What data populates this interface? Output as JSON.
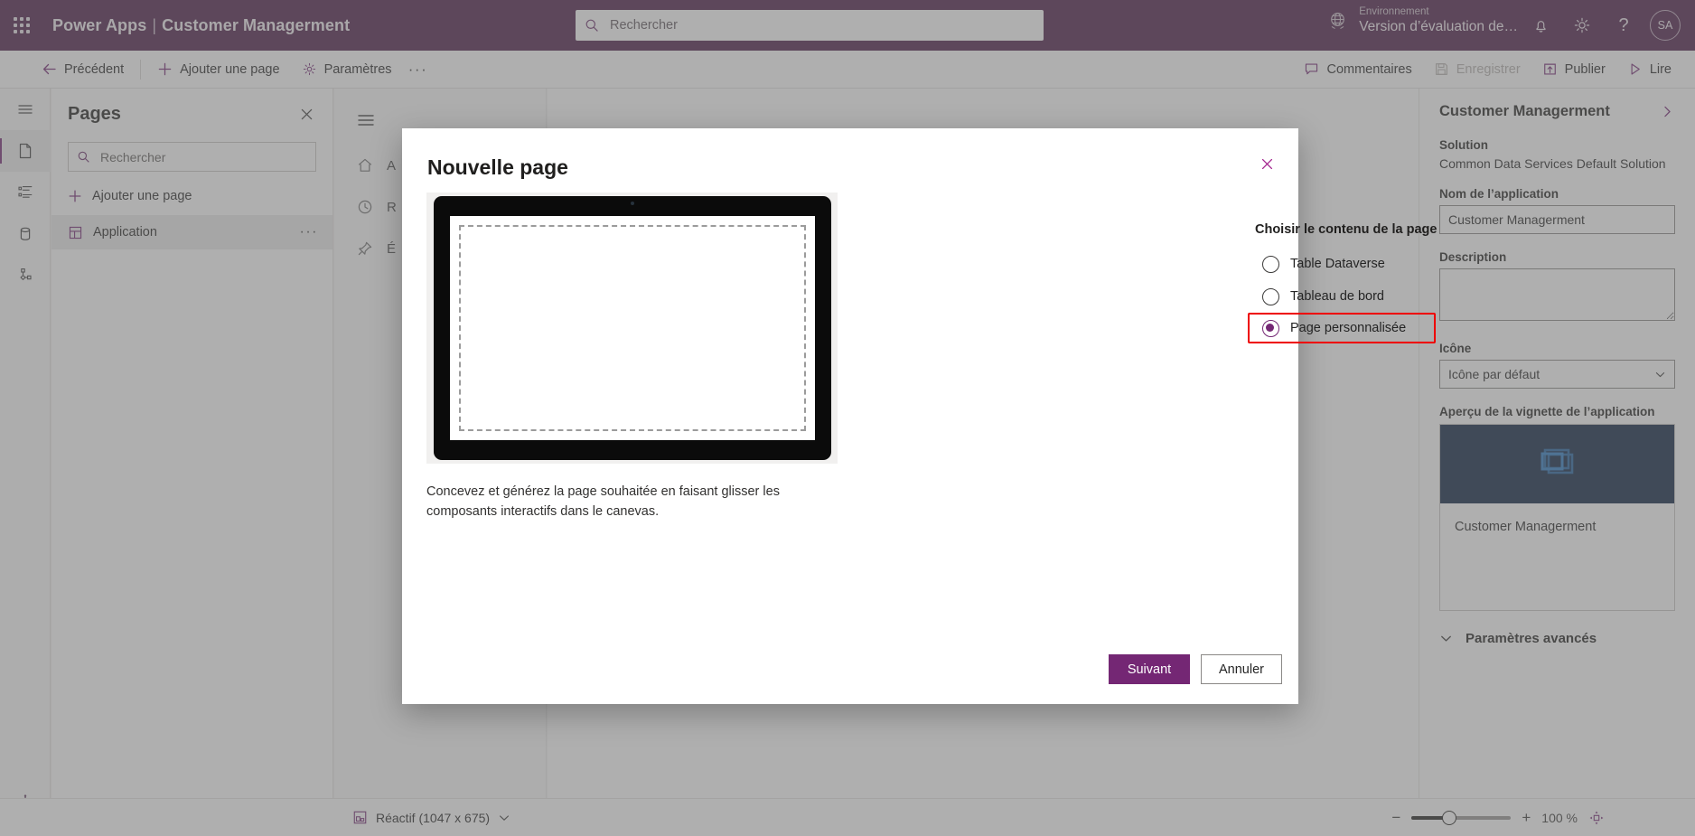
{
  "suitebar": {
    "waffle_icon": "app-launcher-icon",
    "brand": "Power Apps",
    "separator": "|",
    "app_name": "Customer Managerment",
    "search": {
      "placeholder": "Rechercher",
      "value": "",
      "icon": "search-icon"
    },
    "environment": {
      "label": "Environnement",
      "value": "Version d’évaluation de…",
      "icon": "globe-icon"
    },
    "icons": [
      {
        "name": "notification-bell-icon",
        "glyph": "bell"
      },
      {
        "name": "settings-gear-icon",
        "glyph": "gear"
      },
      {
        "name": "help-question-icon",
        "glyph": "question"
      }
    ],
    "avatar_initials": "SA",
    "accent": "#4a1a45"
  },
  "commandbar": {
    "back": "Précédent",
    "add_page": "Ajouter une page",
    "settings": "Paramètres",
    "overflow": "···",
    "comments": "Commentaires",
    "save": "Enregistrer",
    "save_disabled": true,
    "publish": "Publier",
    "play": "Lire"
  },
  "rail": {
    "items": [
      {
        "name": "hamburger-menu-icon",
        "label": "Menu",
        "selected": false
      },
      {
        "name": "pages-icon",
        "label": "Pages",
        "selected": true
      },
      {
        "name": "navigation-icon",
        "label": "Navigation",
        "selected": false
      },
      {
        "name": "data-icon",
        "label": "Données",
        "selected": false
      },
      {
        "name": "automation-icon",
        "label": "Automatisation",
        "selected": false
      }
    ],
    "bottom": {
      "name": "copilot-robot-icon",
      "label": "Copilot"
    }
  },
  "pages_panel": {
    "title": "Pages",
    "close_icon": "close-icon",
    "search": {
      "placeholder": "Rechercher",
      "value": "",
      "icon": "search-icon"
    },
    "add_page": "Ajouter une page",
    "items": [
      {
        "label": "Application",
        "icon": "app-page-icon",
        "selected": true,
        "more": "···"
      }
    ]
  },
  "canvas_sitemap": {
    "hamburger": "hamburger-menu-icon",
    "items": [
      {
        "icon": "home-icon",
        "label": "A"
      },
      {
        "icon": "recent-clock-icon",
        "label": "R"
      },
      {
        "icon": "pin-icon",
        "label": "É"
      }
    ]
  },
  "dialog": {
    "title": "Nouvelle page",
    "close_icon": "close-icon",
    "description": "Concevez et générez la page souhaitée en faisant glisser les composants interactifs dans le canevas.",
    "choose_label": "Choisir le contenu de la page",
    "options": [
      {
        "label": "Table Dataverse",
        "selected": false,
        "highlighted": false
      },
      {
        "label": "Tableau de bord",
        "selected": false,
        "highlighted": false
      },
      {
        "label": "Page personnalisée",
        "selected": true,
        "highlighted": true
      }
    ],
    "highlight_color": "#ee0000",
    "primary_button": "Suivant",
    "secondary_button": "Annuler"
  },
  "properties": {
    "title": "Customer Managerment",
    "chevron_icon": "chevron-right-icon",
    "solution_label": "Solution",
    "solution_value": "Common Data Services Default Solution",
    "app_name_label": "Nom de l’application",
    "app_name_value": "Customer Managerment",
    "description_label": "Description",
    "description_value": "",
    "icon_label": "Icône",
    "icon_value": "Icône par défaut",
    "icon_chevron": "chevron-down-icon",
    "thumbnail_label": "Aperçu de la vignette de l’application",
    "thumbnail_name": "Customer Managerment",
    "thumbnail_bg": "#09203f",
    "advanced_label": "Paramètres avancés",
    "advanced_chevron": "chevron-down-icon"
  },
  "statusbar": {
    "device_icon": "responsive-layout-icon",
    "device_label": "Réactif (1047 x 675)",
    "device_chevron": "chevron-down-icon",
    "zoom_out": "−",
    "zoom_in": "+",
    "zoom_value": "100 %",
    "fit_icon": "fit-to-screen-icon"
  }
}
